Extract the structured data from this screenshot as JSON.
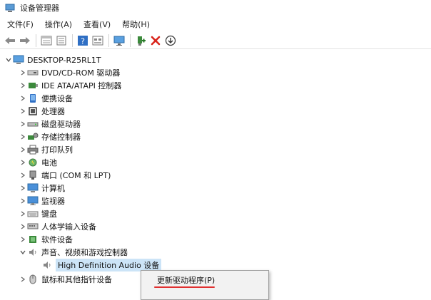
{
  "window": {
    "title": "设备管理器"
  },
  "menubar": {
    "items": [
      "文件(F)",
      "操作(A)",
      "查看(V)",
      "帮助(H)"
    ]
  },
  "toolbar": {
    "icons": [
      "back-arrow-icon",
      "forward-arrow-icon",
      "properties-icon",
      "update-driver-icon",
      "help-icon",
      "view-icon",
      "monitor-icon",
      "add-driver-icon",
      "uninstall-icon",
      "download-icon"
    ]
  },
  "tree": {
    "root": "DESKTOP-R25RL1T",
    "categories": [
      {
        "label": "DVD/CD-ROM 驱动器",
        "icon": "dvd-drive-icon"
      },
      {
        "label": "IDE ATA/ATAPI 控制器",
        "icon": "ide-controller-icon"
      },
      {
        "label": "便携设备",
        "icon": "portable-device-icon"
      },
      {
        "label": "处理器",
        "icon": "processor-icon"
      },
      {
        "label": "磁盘驱动器",
        "icon": "disk-drive-icon"
      },
      {
        "label": "存储控制器",
        "icon": "storage-controller-icon"
      },
      {
        "label": "打印队列",
        "icon": "printer-icon"
      },
      {
        "label": "电池",
        "icon": "battery-icon"
      },
      {
        "label": "端口 (COM 和 LPT)",
        "icon": "port-icon"
      },
      {
        "label": "计算机",
        "icon": "computer-icon"
      },
      {
        "label": "监视器",
        "icon": "monitor-icon"
      },
      {
        "label": "键盘",
        "icon": "keyboard-icon"
      },
      {
        "label": "人体学输入设备",
        "icon": "hid-icon"
      },
      {
        "label": "软件设备",
        "icon": "software-device-icon"
      },
      {
        "label": "声音、视频和游戏控制器",
        "icon": "speaker-icon",
        "expanded": true
      }
    ],
    "child": {
      "label": "High Definition Audio 设备",
      "icon": "audio-device-icon"
    },
    "partial_next": {
      "label": "鼠标和其他指针设备",
      "icon": "mouse-icon"
    }
  },
  "context_menu": {
    "items": [
      "更新驱动程序(P)"
    ]
  },
  "colors": {
    "selection": "#cce4f7",
    "highlight_underline": "#e03030"
  }
}
